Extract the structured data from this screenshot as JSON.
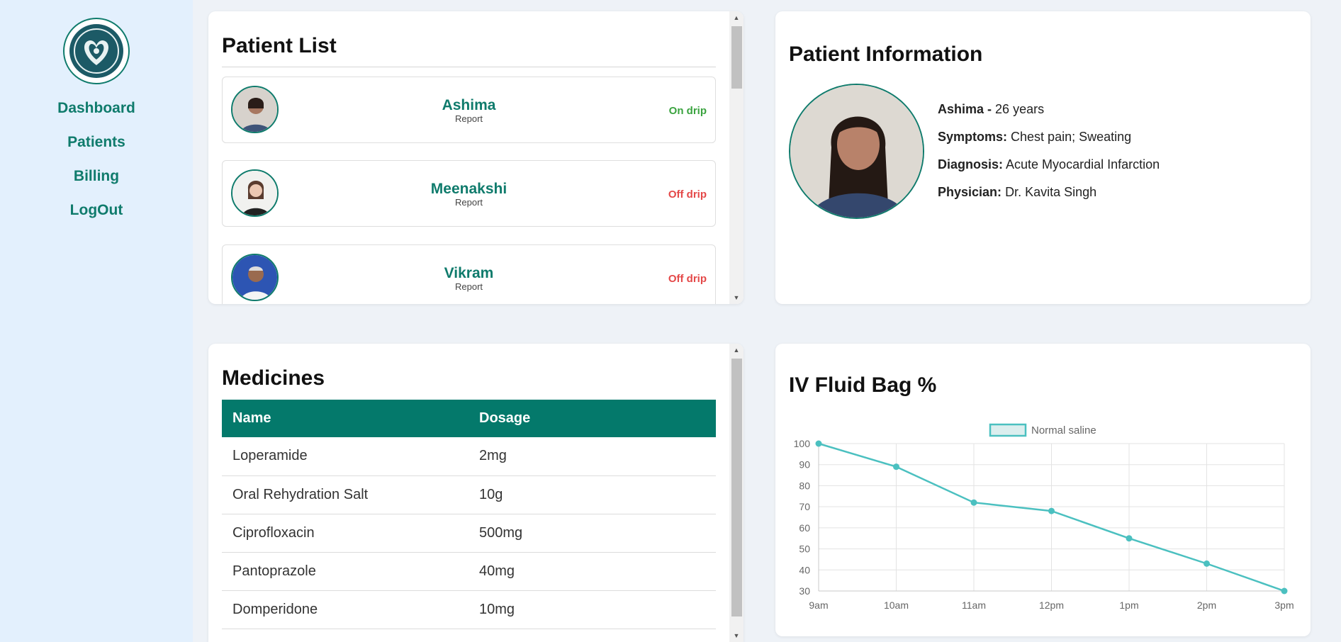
{
  "sidebar": {
    "logo_icon": "heart-emblem-logo",
    "nav": [
      "Dashboard",
      "Patients",
      "Billing",
      "LogOut"
    ]
  },
  "patient_list": {
    "title": "Patient List",
    "patients": [
      {
        "name": "Ashima",
        "sub": "Report",
        "status": "On drip",
        "status_color": "#3aa33f"
      },
      {
        "name": "Meenakshi",
        "sub": "Report",
        "status": "Off drip",
        "status_color": "#e44848"
      },
      {
        "name": "Vikram",
        "sub": "Report",
        "status": "Off drip",
        "status_color": "#e44848"
      }
    ]
  },
  "patient_info": {
    "title": "Patient Information",
    "name": "Ashima -",
    "age": "26 years",
    "symptoms_label": "Symptoms:",
    "symptoms": "Chest pain; Sweating",
    "diagnosis_label": "Diagnosis:",
    "diagnosis": "Acute Myocardial Infarction",
    "physician_label": "Physician:",
    "physician": "Dr. Kavita Singh"
  },
  "medicines": {
    "title": "Medicines",
    "headers": [
      "Name",
      "Dosage"
    ],
    "rows": [
      [
        "Loperamide",
        "2mg"
      ],
      [
        "Oral Rehydration Salt",
        "10g"
      ],
      [
        "Ciprofloxacin",
        "500mg"
      ],
      [
        "Pantoprazole",
        "40mg"
      ],
      [
        "Domperidone",
        "10mg"
      ]
    ]
  },
  "chart_title": "IV Fluid Bag %",
  "chart_data": {
    "type": "line",
    "title": "",
    "xlabel": "",
    "ylabel": "",
    "categories": [
      "9am",
      "10am",
      "11am",
      "12pm",
      "1pm",
      "2pm",
      "3pm"
    ],
    "series": [
      {
        "name": "Normal saline",
        "values": [
          100,
          89,
          72,
          68,
          55,
          43,
          30
        ],
        "color": "#4bc0c0"
      }
    ],
    "ylim": [
      30,
      100
    ],
    "yticks": [
      30,
      40,
      50,
      60,
      70,
      80,
      90,
      100
    ],
    "grid": true,
    "legend": "top-center"
  },
  "colors": {
    "brand": "#0f7b6c",
    "table_header": "#04796b",
    "sidebar_bg": "#e3f0fd",
    "page_bg": "#eef2f7"
  }
}
